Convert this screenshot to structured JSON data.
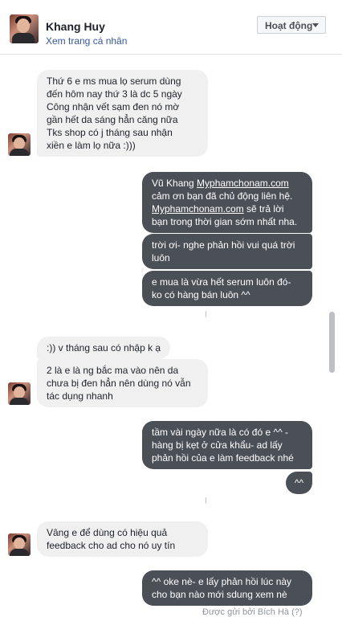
{
  "header": {
    "name": "Khang Huy",
    "profile_link": "Xem trang cá nhân",
    "status_label": "Hoạt động"
  },
  "messages": {
    "m1": [
      "Thứ 6 e ms mua lọ serum dùng",
      "đến hôm nay thứ 3 là dc 5 ngày",
      "Công nhận vết sạm đen nó mờ",
      "gần hết da sáng hẳn căng nữa",
      "Tks shop có j tháng sau nhận",
      "xiền e làm lọ nữa :)))"
    ],
    "m2": {
      "l1_pre": "Vũ Khang ",
      "l1_link": "Myphamchonam.com",
      "l2": "cảm ơn bạn đã chủ động liên hệ.",
      "l3_link": "Myphamchonam.com",
      "l3_post": " sẽ trả lời",
      "l4": "bạn trong thời gian sớm nhất nha."
    },
    "m3": [
      "trời ơi- nghe phản hồi vui quá trời",
      "luôn"
    ],
    "m4": [
      "e mua là vừa hết serum luôn đó-",
      "ko có hàng bán luôn ^^"
    ],
    "m5": ":)) v tháng sau có nhập k ạ",
    "m6": [
      "2 là e là ng bắc ma vào nên da",
      "chưa bị đen hẳn nên dùng nó vẫn",
      "tác dụng nhanh"
    ],
    "m7": [
      "tầm vài ngày nữa là có đó e ^^ -",
      "hàng bị kẹt ở cửa khẩu- ad lấy",
      "phản hồi của e làm feedback nhé"
    ],
    "m8": "^^",
    "m9": [
      "Vâng e để dùng có hiệu quả",
      "feedback cho ad cho nó uy tín"
    ],
    "m10": [
      "^^ oke nè- e lấy phản hồi lúc này",
      "cho bạn nào mới sdung xem nè"
    ]
  },
  "footer": "Được gửi bởi Bích Hà (?)"
}
